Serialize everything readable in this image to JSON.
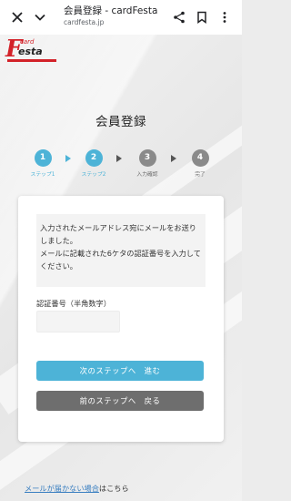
{
  "browser": {
    "title": "会員登録 - cardFesta",
    "url": "cardfesta.jp",
    "icons": [
      "close-icon",
      "chevron-down-icon",
      "share-icon",
      "bookmark-icon",
      "more-vertical-icon"
    ]
  },
  "logo": {
    "letter": "F",
    "card": "card",
    "festa": "esta",
    "brand_color": "#d32229"
  },
  "page": {
    "title": "会員登録"
  },
  "steps": [
    {
      "number": "1",
      "label": "ステップ1",
      "state": "active"
    },
    {
      "number": "2",
      "label": "ステップ2",
      "state": "active"
    },
    {
      "number": "3",
      "label": "入力確認",
      "state": "inactive"
    },
    {
      "number": "4",
      "label": "完了",
      "state": "inactive"
    }
  ],
  "notice": {
    "line1": "入力されたメールアドレス宛にメールをお送りしました。",
    "line2": "メールに記載された6ケタの認証番号を入力してください。"
  },
  "form": {
    "code_label": "認証番号（半角数字）",
    "code_value": ""
  },
  "buttons": {
    "next": "次のステップへ　進む",
    "back": "前のステップへ　戻る"
  },
  "footer": {
    "link_text": "メールが届かない場合",
    "suffix": "はこちら"
  },
  "colors": {
    "accent": "#4db3d7",
    "inactive": "#8a8a8a",
    "back_button": "#6e6e6e",
    "link": "#3a7fc1"
  }
}
